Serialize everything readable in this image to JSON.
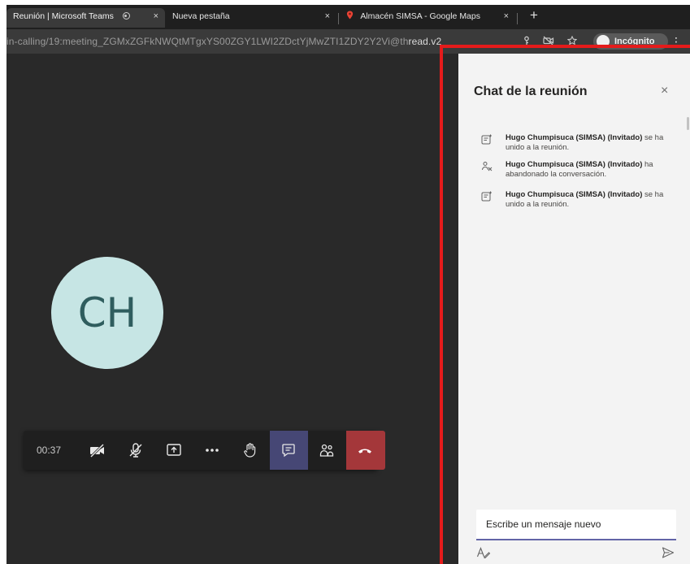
{
  "browser": {
    "tabs": [
      {
        "title": "Reunión | Microsoft Teams",
        "active": true,
        "recording_icon": "recording-icon",
        "close": "×"
      },
      {
        "title": "Nueva pestaña",
        "active": false,
        "close": "×"
      },
      {
        "title": "Almacén SIMSA - Google Maps",
        "active": false,
        "icon": "maps-pin-icon",
        "close": "×"
      }
    ],
    "new_tab": "+",
    "url_dim": "in-calling/19:meeting_ZGMxZGFkNWQtMTgxYS00ZGY1LWI2ZDctYjMwZTI1ZDY2Y2Vi@th",
    "url_bright": "read.v2",
    "incognito_label": "Incógnito",
    "menu": "⋮"
  },
  "meeting": {
    "avatar_initials": "CH",
    "timer": "00:37",
    "controls": [
      {
        "name": "camera-off-button",
        "icon": "camera-off-icon"
      },
      {
        "name": "mic-off-button",
        "icon": "mic-off-icon"
      },
      {
        "name": "share-screen-button",
        "icon": "share-screen-icon"
      },
      {
        "name": "more-actions-button",
        "icon": "more-icon"
      },
      {
        "name": "raise-hand-button",
        "icon": "hand-icon"
      },
      {
        "name": "chat-button",
        "icon": "chat-icon"
      },
      {
        "name": "participants-button",
        "icon": "people-icon"
      },
      {
        "name": "hang-up-button",
        "icon": "phone-hangup-icon"
      }
    ],
    "colors": {
      "stage": "#292929",
      "avatar_bg": "#c6e5e4",
      "chat_active": "#464775",
      "hangup": "#a4373a",
      "annotation": "#e51b1b"
    }
  },
  "chat": {
    "title": "Chat de la reunión",
    "close": "×",
    "events": [
      {
        "icon": "person-joined-icon",
        "who": "Hugo Chumpisuca (SIMSA) (Invitado)",
        "what": " se ha unido a la reunión."
      },
      {
        "icon": "person-left-icon",
        "who": "Hugo Chumpisuca (SIMSA) (Invitado)",
        "what": " ha abandonado la conversación."
      },
      {
        "icon": "person-joined-icon",
        "who": "Hugo Chumpisuca (SIMSA) (Invitado)",
        "what": " se ha unido a la reunión."
      }
    ],
    "compose_placeholder": "Escribe un mensaje nuevo"
  }
}
